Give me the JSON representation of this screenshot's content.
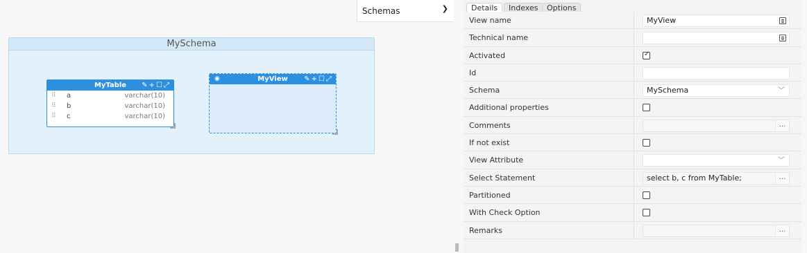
{
  "schema_selector": {
    "label": "Schemas",
    "chevron_icon": "chevron-down-icon"
  },
  "diagram": {
    "schema_title": "MySchema",
    "table": {
      "name": "MyTable",
      "tool_icons": [
        "pin-icon",
        "add-icon",
        "edit-icon",
        "expand-icon"
      ],
      "columns": [
        {
          "name": "a",
          "type": "varchar(10)"
        },
        {
          "name": "b",
          "type": "varchar(10)"
        },
        {
          "name": "c",
          "type": "varchar(10)"
        }
      ]
    },
    "view": {
      "name": "MyView",
      "icon": "eye-icon"
    }
  },
  "tabs": [
    {
      "label": "Details",
      "active": true
    },
    {
      "label": "Indexes",
      "active": false
    },
    {
      "label": "Options",
      "active": false
    }
  ],
  "properties": [
    {
      "label": "View name",
      "type": "text",
      "value": "MyView",
      "button": "list"
    },
    {
      "label": "Technical name",
      "type": "text",
      "value": "",
      "button": "list"
    },
    {
      "label": "Activated",
      "type": "checkbox",
      "checked": true
    },
    {
      "label": "Id",
      "type": "text",
      "value": ""
    },
    {
      "label": "Schema",
      "type": "select",
      "value": "MySchema"
    },
    {
      "label": "Additional properties",
      "type": "checkbox",
      "checked": false
    },
    {
      "label": "Comments",
      "type": "text-muted",
      "value": "",
      "button": "dots"
    },
    {
      "label": "If not exist",
      "type": "checkbox",
      "checked": false
    },
    {
      "label": "View Attribute",
      "type": "select",
      "value": ""
    },
    {
      "label": "Select Statement",
      "type": "text-muted",
      "value": "select b, c from MyTable;",
      "button": "dots"
    },
    {
      "label": "Partitioned",
      "type": "checkbox",
      "checked": false
    },
    {
      "label": "With Check Option",
      "type": "checkbox",
      "checked": false
    },
    {
      "label": "Remarks",
      "type": "text-muted",
      "value": "",
      "button": "dots"
    }
  ],
  "ui": {
    "dots_label": "...",
    "caret_icon": "﹀"
  }
}
